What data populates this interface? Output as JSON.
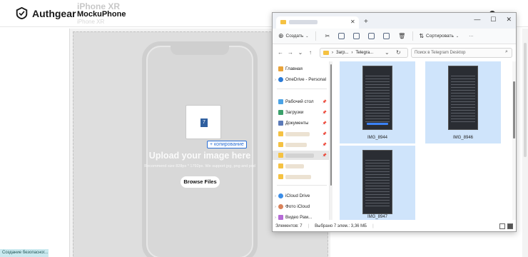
{
  "site": {
    "brand": "Authgear",
    "device_title": "iPhone XR",
    "product": "MockuPhone",
    "product_ghost": "iPhone XR"
  },
  "upload": {
    "title": "Upload your image here",
    "hint": "Recommend size 828px * 1792px. We support jpg, png and psd",
    "button": "Browse Files",
    "copy_tooltip": "+ копирование",
    "thumb_icon": "7"
  },
  "toast": "Создание безопасног...",
  "explorer": {
    "toolbar": {
      "create": "Создать",
      "sort": "Сортировать",
      "more": "···"
    },
    "address": {
      "crumb1": "Загр...",
      "crumb2": "Telegra...",
      "search_placeholder": "Поиск в Telegram Desktop"
    },
    "nav": {
      "home": "Главная",
      "onedrive": "OneDrive - Personal",
      "desktop": "Рабочий стол",
      "downloads": "Загрузки",
      "documents": "Документы",
      "icloud_drive": "iCloud Drive",
      "icloud_photos": "Фото iCloud",
      "cut_item": "Видео Рам..."
    },
    "files": [
      {
        "name": "IMG_8944",
        "selected": true
      },
      {
        "name": "IMG_8946",
        "selected": true
      },
      {
        "name": "IMG_8947",
        "selected": true
      }
    ],
    "status": {
      "count": "Элементов: 7",
      "selected": "Выбрано 7 элем.: 3,36 МБ"
    }
  },
  "colors": {
    "selection": "#cfe4fb",
    "accent": "#2a6fd6",
    "canvas": "#dedede"
  }
}
